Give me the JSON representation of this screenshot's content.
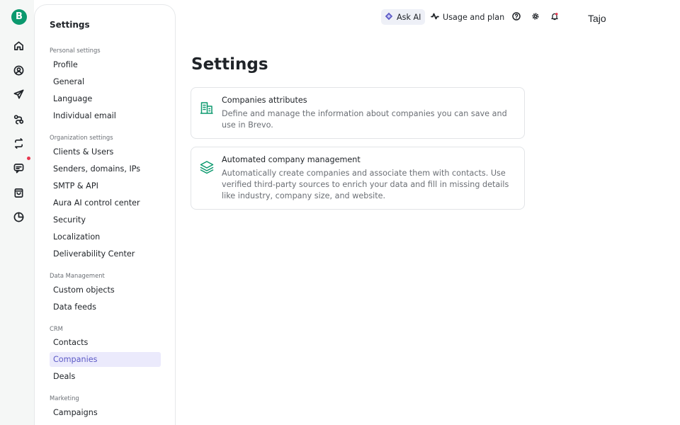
{
  "app": {
    "logo_letter": "B",
    "brand_color": "#0b996e"
  },
  "rail": {
    "icons": [
      "home-icon",
      "contacts-icon",
      "send-icon",
      "automation-icon",
      "transfer-icon",
      "chat-icon",
      "shopping-bag-icon",
      "reports-icon"
    ]
  },
  "sidebar": {
    "title": "Settings",
    "sections": [
      {
        "label": "Personal settings",
        "items": [
          "Profile",
          "General",
          "Language",
          "Individual email"
        ]
      },
      {
        "label": "Organization settings",
        "items": [
          "Clients & Users",
          "Senders, domains, IPs",
          "SMTP & API",
          "Aura AI control center",
          "Security",
          "Localization",
          "Deliverability Center"
        ]
      },
      {
        "label": "Data Management",
        "items": [
          "Custom objects",
          "Data feeds"
        ]
      },
      {
        "label": "CRM",
        "items": [
          "Contacts",
          "Companies",
          "Deals"
        ]
      },
      {
        "label": "Marketing",
        "items": [
          "Campaigns"
        ]
      }
    ],
    "active_item": "Companies"
  },
  "topbar": {
    "ask_ai_label": "Ask AI",
    "usage_label": "Usage and plan",
    "user_name": "Tajo"
  },
  "main": {
    "title": "Settings",
    "cards": [
      {
        "title": "Companies attributes",
        "description": "Define and manage the information about companies you can save and use in Brevo.",
        "icon": "building-icon"
      },
      {
        "title": "Automated company management",
        "description": "Automatically create companies and associate them with contacts. Use verified third-party sources to enrich your data and fill in missing details like industry, company size, and website.",
        "icon": "layers-icon"
      }
    ]
  }
}
